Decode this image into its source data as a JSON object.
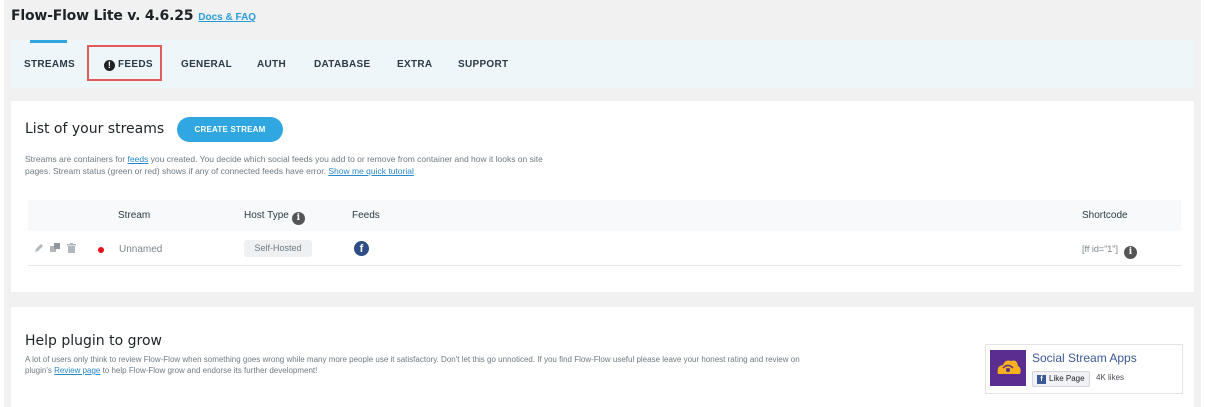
{
  "header": {
    "title": "Flow-Flow Lite v. 4.6.25",
    "docs_link": "Docs & FAQ"
  },
  "tabs": [
    {
      "label": "STREAMS",
      "active": true
    },
    {
      "label": "FEEDS",
      "alert": true,
      "highlighted": true
    },
    {
      "label": "GENERAL"
    },
    {
      "label": "AUTH"
    },
    {
      "label": "DATABASE"
    },
    {
      "label": "EXTRA"
    },
    {
      "label": "SUPPORT"
    }
  ],
  "streams": {
    "title": "List of your streams",
    "create_button": "CREATE STREAM",
    "desc_1": "Streams are containers for ",
    "desc_link_feeds": "feeds",
    "desc_2": " you created. You decide which social feeds you add to or remove from container and how it looks on site",
    "desc_3": "pages. Stream status (green or red) shows if any of connected feeds have error. ",
    "desc_link_tutorial": "Show me quick tutorial",
    "table": {
      "headers": {
        "stream": "Stream",
        "host_type": "Host Type",
        "feeds": "Feeds",
        "shortcode": "Shortcode"
      },
      "rows": [
        {
          "status_color": "#e8101a",
          "name": "Unnamed",
          "host": "Self-Hosted",
          "feed_icon": "facebook-icon",
          "shortcode": "[ff id=\"1\"]"
        }
      ]
    }
  },
  "help": {
    "title": "Help plugin to grow",
    "desc_1": "A lot of users only think to review Flow-Flow when something goes wrong while many more people use it satisfactory. Don't let this go unnoticed. If you find Flow-Flow useful please leave your honest rating and review on",
    "desc_2": "plugin's ",
    "desc_link_review": "Review page",
    "desc_3": " to help Flow-Flow grow and endorse its further development!"
  },
  "fb_widget": {
    "page_name": "Social Stream Apps",
    "like_label": "Like Page",
    "likes": "4K likes"
  },
  "colors": {
    "accent": "#30a7e1",
    "highlight_box": "#e25a5a",
    "status_red": "#e8101a",
    "facebook": "#2e4d87"
  }
}
